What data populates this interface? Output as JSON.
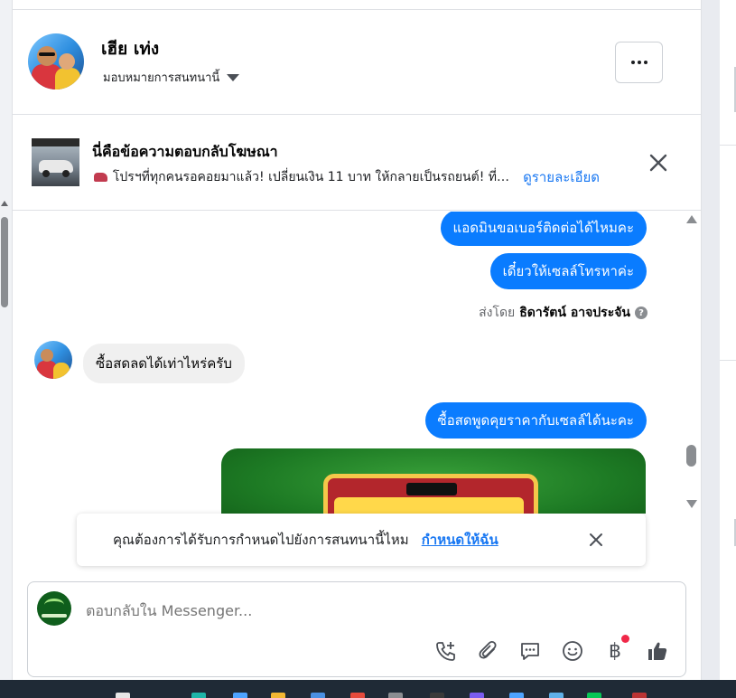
{
  "header": {
    "name": "เฮีย เท่ง",
    "assign_label": "มอบหมายการสนทนานี้"
  },
  "ad": {
    "title": "นี่คือข้อความตอบกลับโฆษณา",
    "description": "โปรฯที่ทุกคนรอคอยมาแล้ว! เปลี่ยนเงิน 11 บาท ให้กลายเป็นรถยนต์! ที่ ...",
    "details_link": "ดูรายละเอียด"
  },
  "messages": {
    "outgoing_1": "แอดมินขอเบอร์ติดต่อได้ไหมคะ",
    "outgoing_2": "เดี๋ยวให้เซลล์โทรหาค่ะ",
    "sent_by_prefix": "ส่งโดย",
    "sent_by_name": "ธิดารัตน์ อาจประจัน",
    "incoming_1": "ซื้อสดลดได้เท่าไหร่ครับ",
    "outgoing_3": "ซื้อสดพูดคุยราคากับเซลล์ได้นะคะ"
  },
  "assign_banner": {
    "text": "คุณต้องการได้รับการกำหนดไปยังการสนทนานี้ไหม",
    "link": "กำหนดให้ฉัน"
  },
  "composer": {
    "placeholder": "ตอบกลับใน Messenger...",
    "tools": [
      "call-add-icon",
      "attachment-icon",
      "saved-reply-icon",
      "emoji-icon",
      "baht-payment-icon",
      "thumbs-up-icon"
    ],
    "baht_symbol": "฿"
  },
  "colors": {
    "outgoing_bubble": "#0a7cff",
    "incoming_bubble": "#f0f0f0",
    "link": "#1877f2",
    "notification_dot": "#f02849"
  }
}
